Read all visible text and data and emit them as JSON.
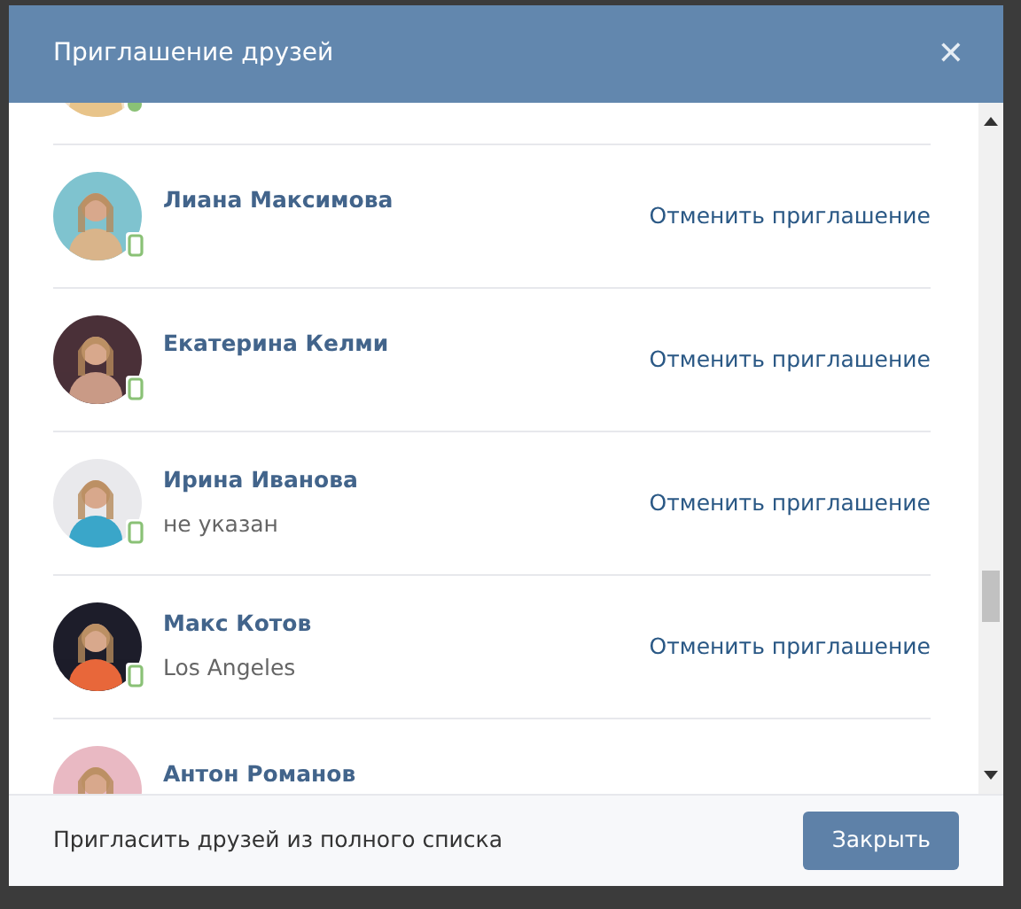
{
  "dialog": {
    "title": "Приглашение друзей",
    "close": "✕"
  },
  "friends": [
    {
      "online": true,
      "mobile": false
    },
    {
      "name": "Лиана Максимова",
      "online": false,
      "mobile": true,
      "action": "Отменить приглашение"
    },
    {
      "name": "Екатерина Келми",
      "online": false,
      "mobile": true,
      "action": "Отменить приглашение"
    },
    {
      "name": "Ирина Иванова",
      "subtitle": "не указан",
      "online": false,
      "mobile": true,
      "action": "Отменить приглашение"
    },
    {
      "name": "Макс Котов",
      "subtitle": "Los Angeles",
      "online": false,
      "mobile": true,
      "action": "Отменить приглашение"
    },
    {
      "name": "Антон Романов",
      "online": false,
      "mobile": false
    }
  ],
  "footer": {
    "link": "Пригласить друзей из полного списка",
    "button": "Закрыть"
  }
}
